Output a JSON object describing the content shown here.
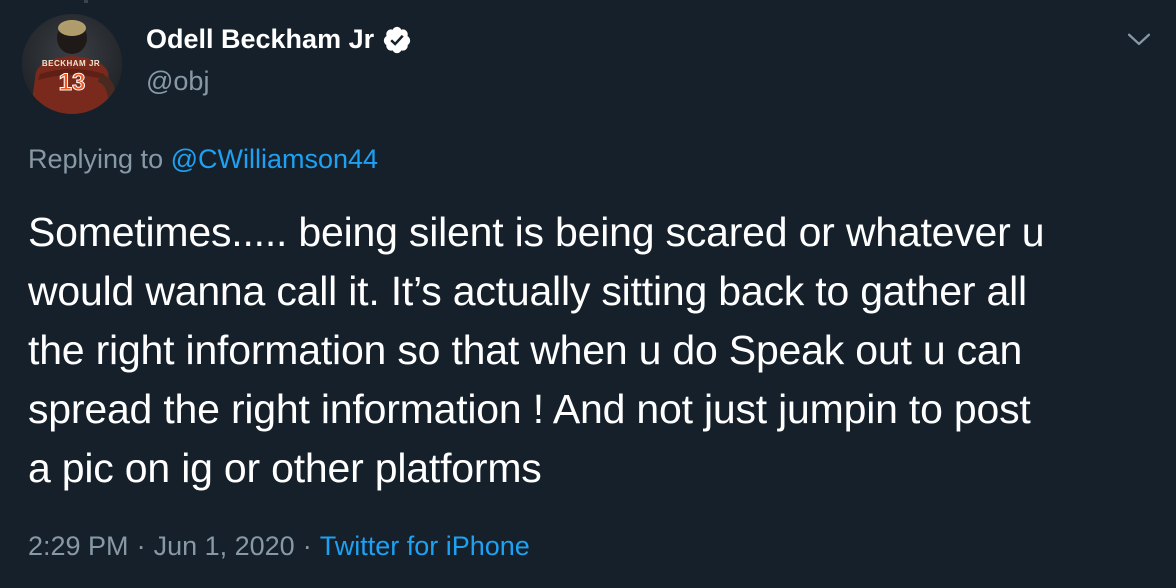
{
  "tweet": {
    "display_name": "Odell Beckham Jr",
    "handle": "@obj",
    "verified": true,
    "avatar": {
      "jersey_name": "BECKHAM JR",
      "jersey_number": "13"
    },
    "replying_prefix": "Replying to",
    "replying_to": "@CWilliamson44",
    "text_lines": [
      "Sometimes..... being silent is being scared or whatever u",
      "would wanna call it. It’s actually sitting back to gather all",
      "the right information so that when u do Speak out u can",
      "spread the right information ! And not just jumpin to post",
      "a pic on ig or other platforms"
    ],
    "time": "2:29 PM",
    "separator": "·",
    "date": "Jun 1, 2020",
    "source": "Twitter for iPhone"
  },
  "colors": {
    "background": "#15202b",
    "text": "#ffffff",
    "secondary": "#8899a6",
    "link": "#1da1f2"
  },
  "icons": {
    "verified": "verified-badge-icon",
    "menu": "chevron-down-icon"
  }
}
